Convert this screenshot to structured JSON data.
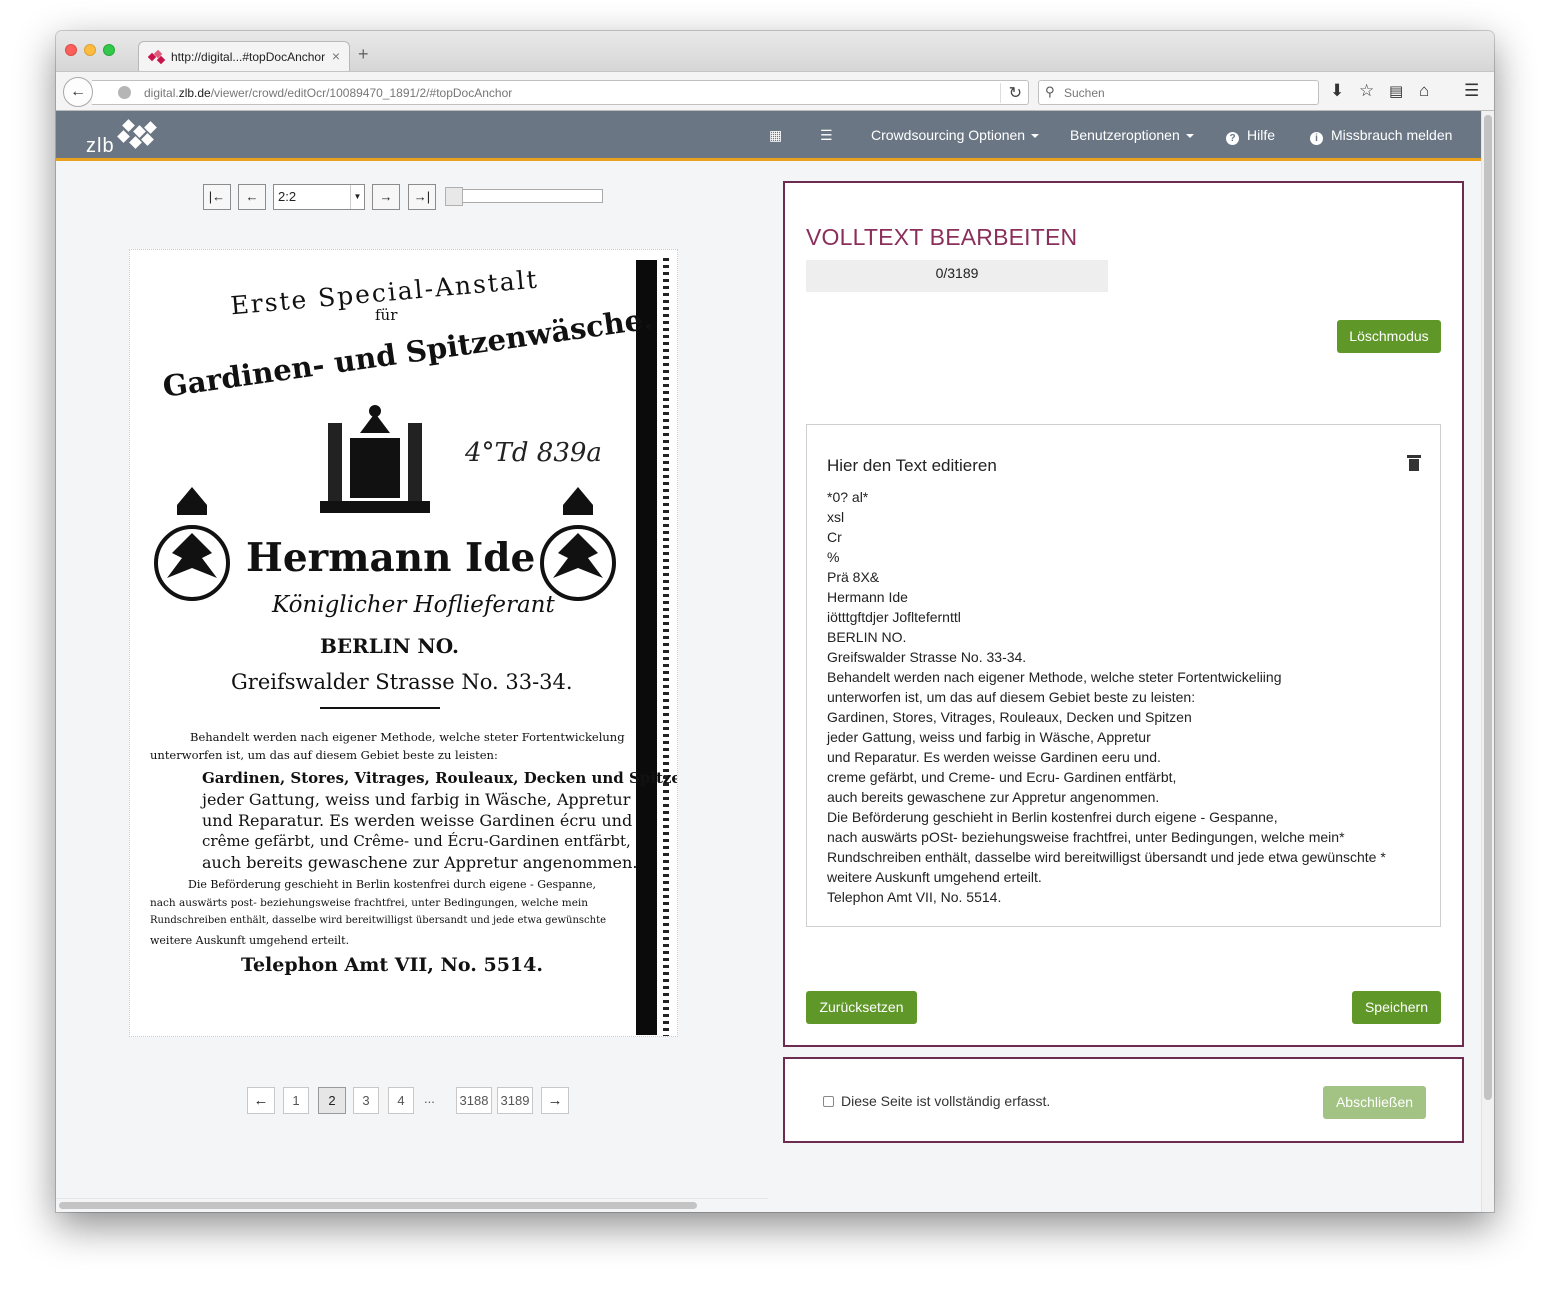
{
  "browser": {
    "tab_title": "http://digital...#topDocAnchor",
    "tab_close": "×",
    "new_tab": "+",
    "back_icon": "←",
    "url_prefix": "digital.",
    "url_domain": "zlb.de",
    "url_path": "/viewer/crowd/editOcr/10089470_1891/2/#topDocAnchor",
    "reload_icon": "↻",
    "search_placeholder": "Suchen",
    "icons": [
      "download-icon",
      "bookmark-star-icon",
      "reading-list-icon",
      "home-icon",
      "menu-icon"
    ]
  },
  "app": {
    "logo": "zlb",
    "nav": {
      "image_icon": "image-icon",
      "list_icon": "list-icon",
      "crowdsourcing": "Crowdsourcing Optionen",
      "user_options": "Benutzeroptionen",
      "help": "Hilfe",
      "report": "Missbrauch melden"
    },
    "accent": "#e7a11e",
    "nav_bg": "#6b7684"
  },
  "viewer": {
    "first_icon": "|←",
    "prev_icon": "←",
    "page_select": "2:2",
    "next_icon": "→",
    "last_icon": "→|",
    "zoom_slider": 0,
    "scan": {
      "line1": "Erste Special-Anstalt",
      "line2": "für",
      "line3": "Gardinen- und Spitzenwäsche.",
      "handwriting": "4°Td 839a",
      "name": "Hermann Ide",
      "title": "Königlicher Hoflieferant",
      "city": "BERLIN NO.",
      "street": "Greifswalder Strasse No. 33-34.",
      "p1a": "Behandelt werden nach eigener Methode, welche steter Fortentwickelung",
      "p1b": "unterworfen ist, um das auf diesem Gebiet beste zu leisten:",
      "p2a": "Gardinen, Stores, Vitrages, Rouleaux, Decken und Spitzen",
      "p2b": "jeder Gattung, weiss und farbig in Wäsche, Appretur",
      "p2c": "und Reparatur. Es werden weisse Gardinen écru und",
      "p2d": "crême gefärbt, und Crême- und Écru-Gardinen entfärbt,",
      "p2e": "auch bereits gewaschene zur Appretur angenommen.",
      "p3a": "Die Beförderung geschieht in Berlin kostenfrei durch eigene - Gespanne,",
      "p3b": "nach auswärts post- beziehungsweise frachtfrei, unter Bedingungen, welche mein",
      "p3c": "Rundschreiben enthält, dasselbe wird bereitwilligst übersandt und jede etwa gewünschte",
      "p3d": "weitere Auskunft umgehend erteilt.",
      "phone": "Telephon Amt VII, No. 5514."
    },
    "pagination": {
      "prev": "←",
      "pages": [
        "1",
        "2",
        "3",
        "4"
      ],
      "active": "2",
      "ellipsis": "...",
      "last_pages": [
        "3188",
        "3189"
      ],
      "next": "→"
    }
  },
  "editor": {
    "heading": "VOLLTEXT BEARBEITEN",
    "progress": "0/3189",
    "delete_mode": "Löschmodus",
    "card_title": "Hier den Text editieren",
    "ocr_lines": [
      "*0? al*",
      "xsl",
      "Cr",
      "%",
      "Prä 8X&",
      "Hermann Ide",
      "iötttgftdjer Jofltefernttl",
      "BERLIN NO.",
      "Greifswalder Strasse No. 33-34.",
      "Behandelt werden nach eigener Methode, welche steter Fortentwickeliing",
      "unterworfen ist, um das auf diesem Gebiet beste zu leisten:",
      "Gardinen, Stores, Vitrages, Rouleaux, Decken und Spitzen",
      "jeder Gattung, weiss und farbig in Wäsche, Appretur",
      "und Reparatur. Es werden weisse Gardinen eeru und.",
      "creme gefärbt, und Creme- und Ecru- Gardinen entfärbt,",
      "auch bereits gewaschene zur Appretur angenommen.",
      "Die Beförderung geschieht in Berlin kostenfrei durch eigene - Gespanne,",
      "nach auswärts pOSt- beziehungsweise frachtfrei, unter Bedingungen, welche mein*",
      "Rundschreiben enthält, dasselbe wird bereitwilligst übersandt und jede etwa gewünschte *",
      "weitere Auskunft umgehend erteilt.",
      "Telephon Amt VII, No. 5514."
    ],
    "reset": "Zurücksetzen",
    "save": "Speichern",
    "complete_checkbox": "Diese Seite ist vollständig erfasst.",
    "complete_checked": false,
    "finish": "Abschließen",
    "border_color": "#6d2b4f",
    "heading_color": "#8a2f5b",
    "button_color": "#5f9828"
  }
}
